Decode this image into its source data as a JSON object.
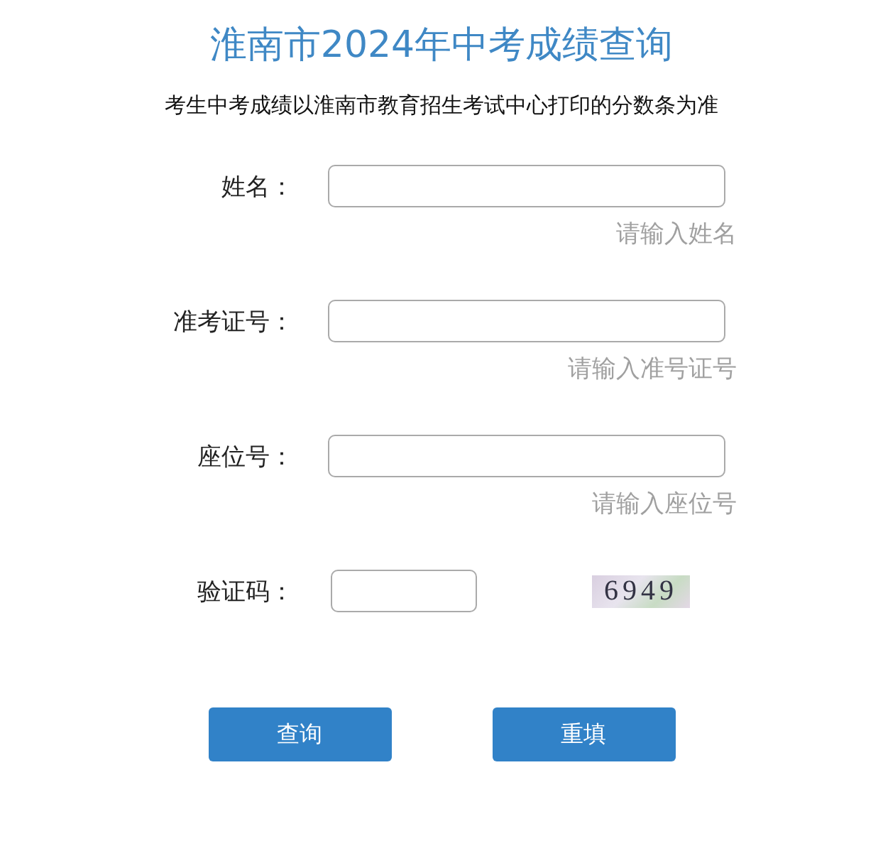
{
  "title": "淮南市2024年中考成绩查询",
  "subtitle": "考生中考成绩以淮南市教育招生考试中心打印的分数条为准",
  "fields": [
    {
      "kind": "text",
      "label": "姓名：",
      "hint": "请输入姓名"
    },
    {
      "kind": "text",
      "label": "准考证号：",
      "hint": "请输入准号证号"
    },
    {
      "kind": "text",
      "label": "座位号：",
      "hint": "请输入座位号"
    },
    {
      "kind": "captcha",
      "label": "验证码：",
      "code": "6949"
    }
  ],
  "buttons": [
    "查询",
    "重填"
  ]
}
